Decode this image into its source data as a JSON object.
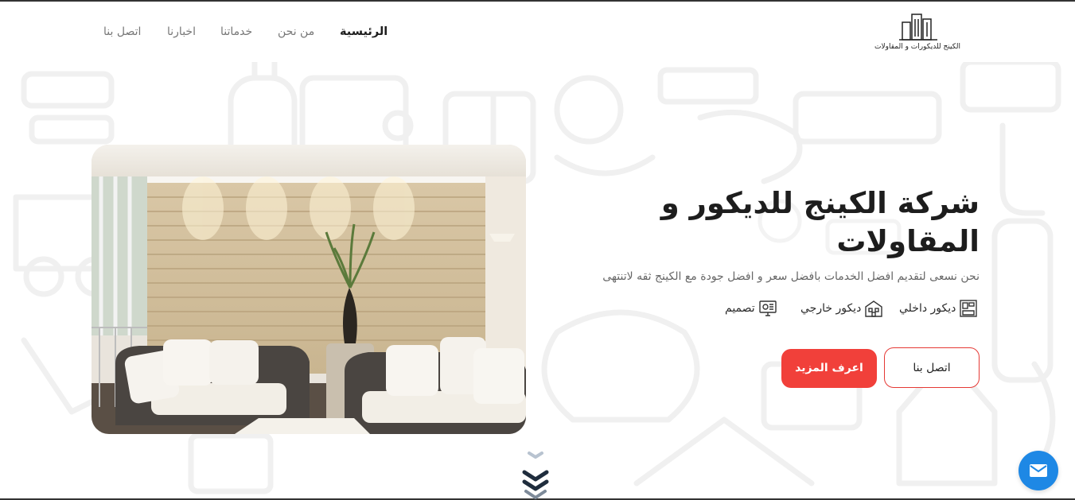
{
  "brand": {
    "logo_text": "الكينج للديكورات و المقاولات"
  },
  "nav": {
    "items": [
      {
        "label": "الرئيسية",
        "active": true
      },
      {
        "label": "من نحن",
        "active": false
      },
      {
        "label": "خدماتنا",
        "active": false
      },
      {
        "label": "اخبارنا",
        "active": false
      },
      {
        "label": "اتصل بنا",
        "active": false
      }
    ]
  },
  "hero": {
    "title": "شركة الكينج للديكور و المقاولات",
    "subtitle": "نحن نسعى لتقديم افضل الخدمات بافضل سعر و افضل جودة مع الكينج ثقه لاتنتهى",
    "features": [
      {
        "label": "ديكور داخلي",
        "icon": "interior-decor-icon"
      },
      {
        "label": "ديكور خارجي",
        "icon": "exterior-decor-icon"
      },
      {
        "label": "تصميم",
        "icon": "design-monitor-icon"
      }
    ],
    "buttons": {
      "contact": "اتصل بنا",
      "learn_more": "اعرف المزيد"
    },
    "image_alt": "living room with stone wall"
  },
  "colors": {
    "accent": "#f1403a",
    "fab": "#1e88e5",
    "text": "#1d1d1d",
    "muted": "#777777"
  },
  "icons": {
    "scroll": "chevron-down-icon",
    "fab": "mail-icon"
  }
}
